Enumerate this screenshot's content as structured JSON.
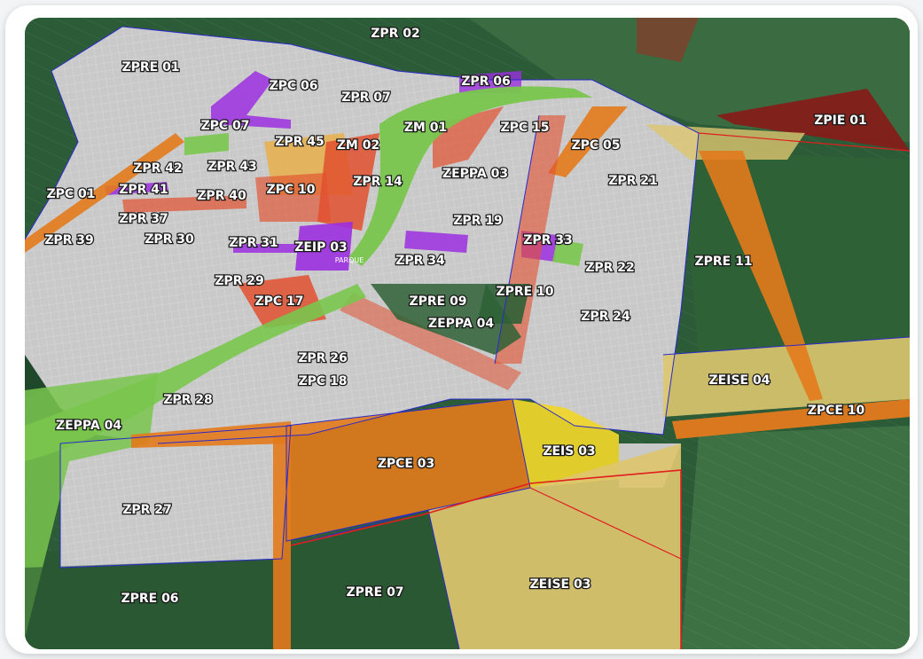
{
  "map": {
    "colors": {
      "background": "#2c5b37",
      "field_dark": "#214a2b",
      "field_mid": "#3a6b41",
      "field_light": "#4f7d45",
      "residential": "#c9c9c9",
      "commercial": "#e2502f",
      "commercial_corridor": "#e37a1c",
      "mixed": "#ef8f4a",
      "expansion": "#e7b04a",
      "environmental": "#79c64e",
      "institutional": "#9b2fe0",
      "social": "#f0d62a",
      "social_expansion": "#ddc66f",
      "industrial": "#8a1a18",
      "boundary": "#e01e1e",
      "zone_line": "#2a2acc"
    },
    "zones": [
      {
        "id": "ZPR 02",
        "label": "ZPR 02"
      },
      {
        "id": "ZPRE 01",
        "label": "ZPRE 01"
      },
      {
        "id": "ZPC 06",
        "label": "ZPC 06"
      },
      {
        "id": "ZPR 07",
        "label": "ZPR 07"
      },
      {
        "id": "ZPR 06",
        "label": "ZPR 06"
      },
      {
        "id": "ZPIE 01",
        "label": "ZPIE 01"
      },
      {
        "id": "ZPC 07",
        "label": "ZPC 07"
      },
      {
        "id": "ZM 01",
        "label": "ZM 01"
      },
      {
        "id": "ZPC 15",
        "label": "ZPC 15"
      },
      {
        "id": "ZPR 45",
        "label": "ZPR 45"
      },
      {
        "id": "ZM 02",
        "label": "ZM 02"
      },
      {
        "id": "ZPC 05",
        "label": "ZPC 05"
      },
      {
        "id": "ZPR 42",
        "label": "ZPR 42"
      },
      {
        "id": "ZPR 43",
        "label": "ZPR 43"
      },
      {
        "id": "ZEPPA 03",
        "label": "ZEPPA 03"
      },
      {
        "id": "ZPC 01",
        "label": "ZPC 01"
      },
      {
        "id": "ZPR 41",
        "label": "ZPR 41"
      },
      {
        "id": "ZPR 40",
        "label": "ZPR 40"
      },
      {
        "id": "ZPC 10",
        "label": "ZPC 10"
      },
      {
        "id": "ZPR 14",
        "label": "ZPR 14"
      },
      {
        "id": "ZPR 21",
        "label": "ZPR 21"
      },
      {
        "id": "ZPR 37",
        "label": "ZPR 37"
      },
      {
        "id": "ZPR 19",
        "label": "ZPR 19"
      },
      {
        "id": "ZPR 39",
        "label": "ZPR 39"
      },
      {
        "id": "ZPR 30",
        "label": "ZPR 30"
      },
      {
        "id": "ZPR 31",
        "label": "ZPR 31"
      },
      {
        "id": "ZEIP 03",
        "label": "ZEIP 03"
      },
      {
        "id": "ZPR 33",
        "label": "ZPR 33"
      },
      {
        "id": "ZPR 34",
        "label": "ZPR 34"
      },
      {
        "id": "ZPRE 11",
        "label": "ZPRE 11"
      },
      {
        "id": "ZPR 22",
        "label": "ZPR 22"
      },
      {
        "id": "ZPR 29",
        "label": "ZPR 29"
      },
      {
        "id": "ZPRE 10",
        "label": "ZPRE 10"
      },
      {
        "id": "ZPC 17",
        "label": "ZPC 17"
      },
      {
        "id": "ZPRE 09",
        "label": "ZPRE 09"
      },
      {
        "id": "ZPR 24",
        "label": "ZPR 24"
      },
      {
        "id": "ZEPPA 04 (center)",
        "label": "ZEPPA 04"
      },
      {
        "id": "ZPR 26",
        "label": "ZPR 26"
      },
      {
        "id": "ZPC 18",
        "label": "ZPC 18"
      },
      {
        "id": "ZEISE 04",
        "label": "ZEISE 04"
      },
      {
        "id": "ZPR 28",
        "label": "ZPR 28"
      },
      {
        "id": "ZPCE 10",
        "label": "ZPCE 10"
      },
      {
        "id": "ZEPPA 04 (west)",
        "label": "ZEPPA 04"
      },
      {
        "id": "ZEIS 03",
        "label": "ZEIS 03"
      },
      {
        "id": "ZPCE 03",
        "label": "ZPCE 03"
      },
      {
        "id": "ZPR 27",
        "label": "ZPR 27"
      },
      {
        "id": "ZEISE 03",
        "label": "ZEISE 03"
      },
      {
        "id": "ZPRE 07",
        "label": "ZPRE 07"
      },
      {
        "id": "ZPRE 06",
        "label": "ZPRE 06"
      }
    ],
    "small_text": "PARQUE"
  }
}
